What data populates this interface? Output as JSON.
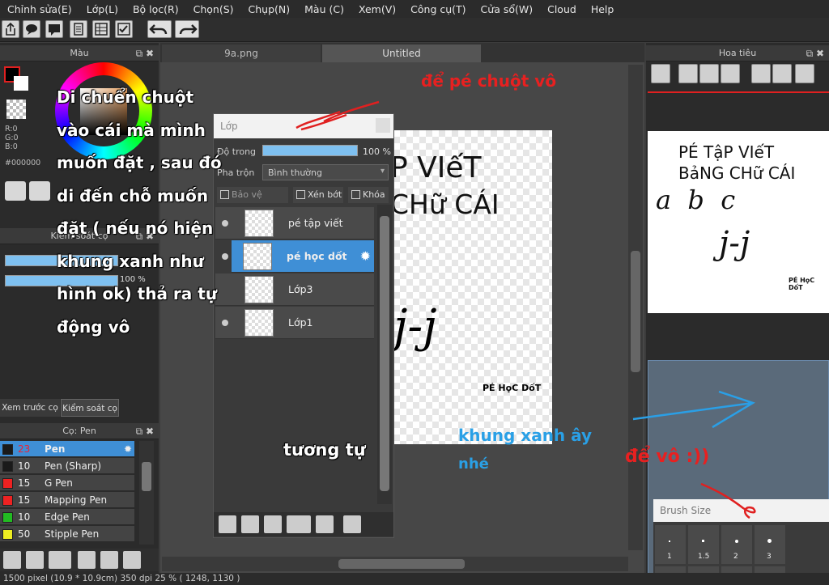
{
  "menu": [
    "Chỉnh sửa(E)",
    "Lớp(L)",
    "Bộ lọc(R)",
    "Chọn(S)",
    "Chụp(N)",
    "Màu (C)",
    "Xem(V)",
    "Công cụ(T)",
    "Cửa sổ(W)",
    "Cloud",
    "Help"
  ],
  "panels": {
    "color_title": "Màu",
    "rgb": [
      "R:0",
      "G:0",
      "B:0"
    ],
    "hex": "#000000",
    "brush_control_title": "Kiểm soát cọ",
    "brush_control_value": "100 %",
    "left_tabs": [
      "Xem trước cọ",
      "Kiểm soát cọ"
    ],
    "brush_title": "Cọ: Pen",
    "navigator_title": "Hoa tiêu"
  },
  "tabs": [
    "9a.png",
    "Untitled"
  ],
  "layer_panel": {
    "title": "Lớp",
    "opacity_label": "Độ trong",
    "opacity_value": "100 %",
    "blend_label": "Pha trộn",
    "blend_value": "Bình thường",
    "checks": [
      "Bảo vệ alpha",
      "Xén bớt",
      "Khóa"
    ],
    "layers": [
      {
        "name": "pé tập viết",
        "selected": false
      },
      {
        "name": "pé học dốt",
        "selected": true
      },
      {
        "name": "Lớp3",
        "selected": false
      },
      {
        "name": "Lớp1",
        "selected": false
      }
    ]
  },
  "brushes": [
    {
      "size": "23",
      "name": "Pen",
      "color": "#1a1a1a",
      "selected": true
    },
    {
      "size": "10",
      "name": "Pen (Sharp)",
      "color": "#1a1a1a",
      "selected": false
    },
    {
      "size": "15",
      "name": "G Pen",
      "color": "#ee2222",
      "selected": false
    },
    {
      "size": "15",
      "name": "Mapping Pen",
      "color": "#ee2222",
      "selected": false
    },
    {
      "size": "10",
      "name": "Edge Pen",
      "color": "#22bb22",
      "selected": false
    },
    {
      "size": "50",
      "name": "Stipple Pen",
      "color": "#eeee22",
      "selected": false
    }
  ],
  "brush_size": {
    "title": "Brush Size",
    "values": [
      "1",
      "1.5",
      "2",
      "3"
    ]
  },
  "canvas_text": {
    "line1": "P VIếT",
    "line2": "CHữ CÁI",
    "face": "j-j",
    "sign": "PÉ HọC DốT"
  },
  "navigator_text": {
    "line1": "PÉ TậP VIếT",
    "line2": "BảNG CHữ CÁI",
    "abc": "a  b  c",
    "face": "j-j",
    "sign": "PÉ HọC DốT"
  },
  "annotations": {
    "main_instruction": [
      "Di chuển chuột",
      "vào cái mà mình",
      "muốn đặt , sau đó",
      "di đến chỗ muốn",
      "đặt ( nếu nó hiện",
      "khung xanh như",
      "hình ok) thả ra tự",
      "động vô"
    ],
    "red_top": "để pé chuột vô",
    "blue": [
      "khung xanh ây",
      "nhé"
    ],
    "red_right": "để vô :))",
    "similar": "tương tự"
  },
  "status": "1500 pixel  (10.9 * 10.9cm)  350 dpi  25 %  ( 1248, 1130 )",
  "colors": {
    "accent": "#3f8fd6",
    "red": "#ee2020",
    "blue": "#2aa0e6"
  }
}
